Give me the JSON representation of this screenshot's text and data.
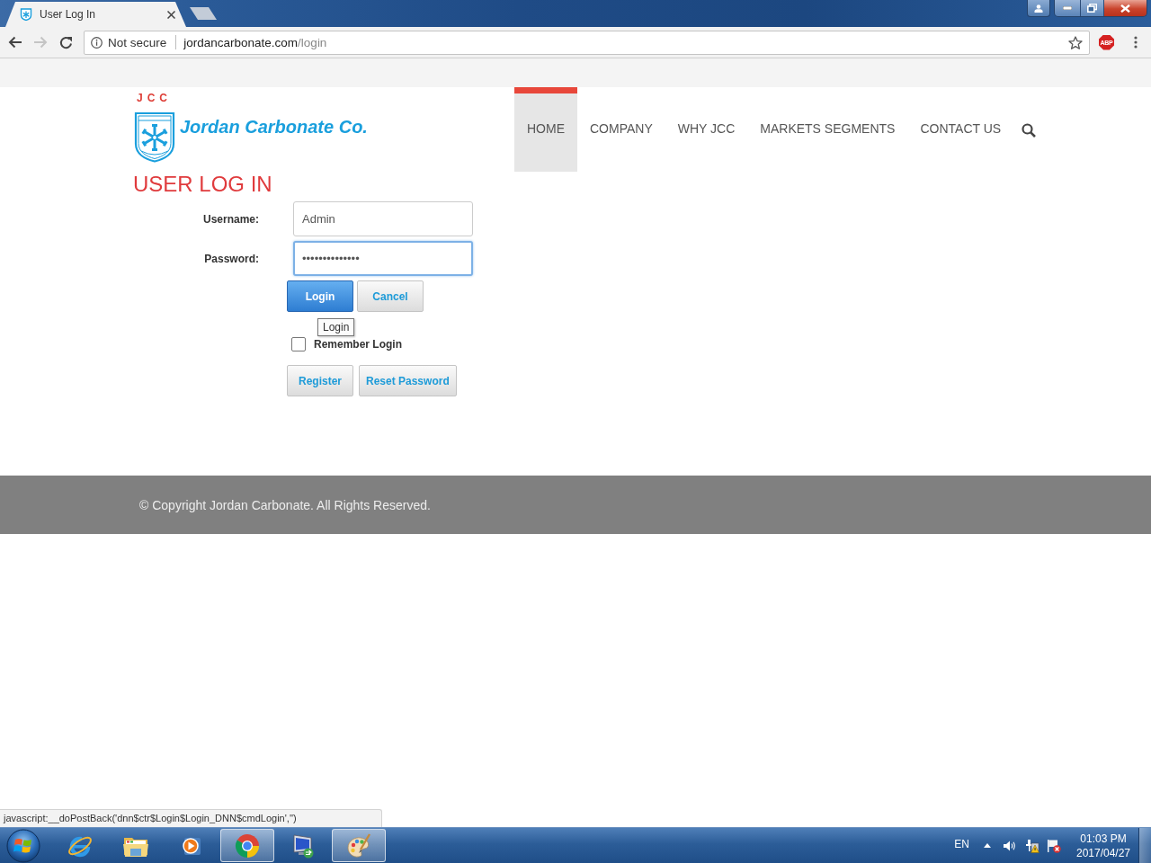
{
  "browser": {
    "tab": {
      "title": "User Log In"
    },
    "navigation": {
      "forward_disabled": true
    },
    "address": {
      "security": "Not secure",
      "domain": "jordancarbonate.com",
      "path": "/login"
    },
    "extensions": [
      {
        "label": "ABP"
      }
    ],
    "status_text": "javascript:__doPostBack('dnn$ctr$Login$Login_DNN$cmdLogin','')"
  },
  "header": {
    "logo": {
      "initials": "JCC",
      "name": "Jordan Carbonate Co."
    },
    "nav": [
      {
        "label": "HOME",
        "selected": true
      },
      {
        "label": "COMPANY",
        "selected": false
      },
      {
        "label": "WHY JCC",
        "selected": false
      },
      {
        "label": "MARKETS SEGMENTS",
        "selected": false
      },
      {
        "label": "CONTACT US",
        "selected": false
      }
    ]
  },
  "login": {
    "title": "USER LOG IN",
    "fields": [
      {
        "label": "Username:",
        "value": "Admin",
        "focused": false
      },
      {
        "label": "Password:",
        "value": "••••••••••••••",
        "focused": true
      }
    ],
    "buttons": [
      {
        "label": "Login",
        "kind": "primary"
      },
      {
        "label": "Cancel",
        "kind": "secondary"
      }
    ],
    "tooltip": "Login",
    "remember": {
      "label": "Remember Login",
      "checked": false
    },
    "account_buttons": [
      {
        "label": "Register"
      },
      {
        "label": "Reset Password"
      }
    ]
  },
  "footer": {
    "copyright": "© Copyright Jordan Carbonate. All Rights Reserved."
  },
  "taskbar": {
    "apps": [
      {
        "kind": "ie",
        "open": false
      },
      {
        "kind": "folder",
        "open": false
      },
      {
        "kind": "player",
        "open": false
      },
      {
        "kind": "chrome",
        "open": true
      },
      {
        "kind": "remote",
        "open": false
      },
      {
        "kind": "paint",
        "open": true
      }
    ],
    "tray": {
      "language": "EN",
      "time": "01:03 PM",
      "date": "2017/04/27"
    }
  }
}
